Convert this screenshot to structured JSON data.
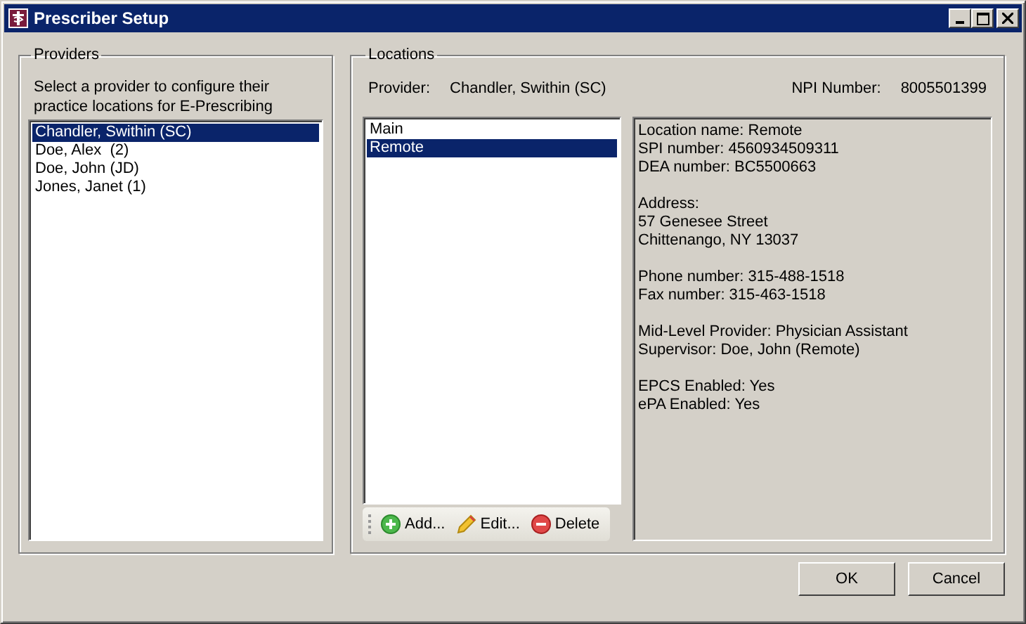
{
  "window": {
    "title": "Prescriber Setup"
  },
  "providers": {
    "title": "Providers",
    "instruction": "Select a provider to configure their practice locations for E-Prescribing",
    "items": [
      {
        "label": "Chandler, Swithin (SC)",
        "selected": true
      },
      {
        "label": "Doe, Alex  (2)",
        "selected": false
      },
      {
        "label": "Doe, John (JD)",
        "selected": false
      },
      {
        "label": "Jones, Janet (1)",
        "selected": false
      }
    ]
  },
  "locations": {
    "title": "Locations",
    "provider_label": "Provider:",
    "provider_value": "Chandler, Swithin (SC)",
    "npi_label": "NPI Number:",
    "npi_value": "8005501399",
    "items": [
      {
        "label": "Main",
        "selected": false
      },
      {
        "label": "Remote",
        "selected": true
      }
    ],
    "details": [
      [
        "Location name: Remote",
        "SPI number: 4560934509311",
        "DEA number: BC5500663"
      ],
      [
        "Address:",
        "57 Genesee Street",
        "Chittenango, NY 13037"
      ],
      [
        "Phone number: 315-488-1518",
        "Fax number: 315-463-1518"
      ],
      [
        "Mid-Level Provider: Physician Assistant",
        "Supervisor: Doe, John (Remote)"
      ],
      [
        "EPCS Enabled: Yes",
        "ePA Enabled: Yes"
      ]
    ],
    "toolbar": [
      {
        "kind": "add",
        "label": "Add..."
      },
      {
        "kind": "edit",
        "label": "Edit..."
      },
      {
        "kind": "delete",
        "label": "Delete"
      }
    ]
  },
  "buttons": [
    "OK",
    "Cancel"
  ]
}
